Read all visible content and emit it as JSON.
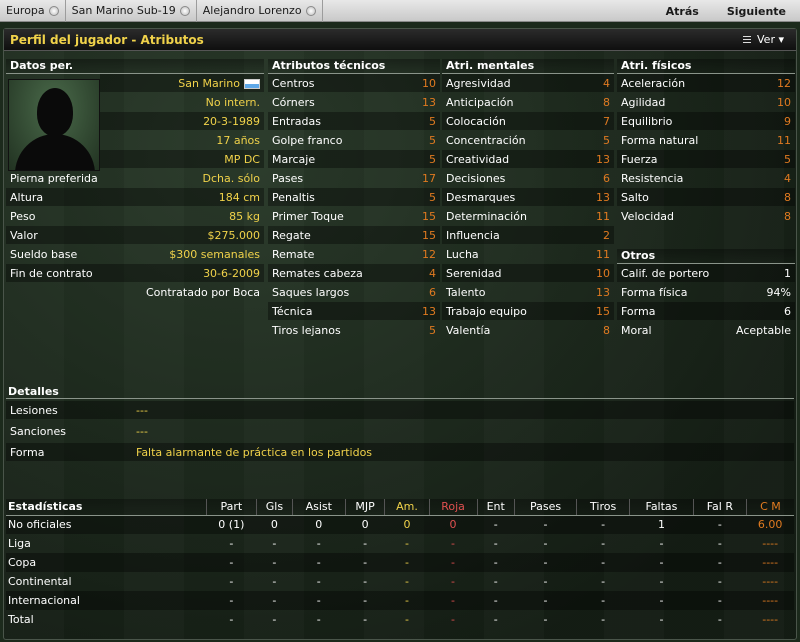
{
  "nav": {
    "crumbs": [
      "Europa",
      "San Marino Sub-19",
      "Alejandro Lorenzo"
    ],
    "back": "Atrás",
    "next": "Siguiente"
  },
  "panel": {
    "title": "Perfil del jugador - Atributos",
    "view_button": "Ver"
  },
  "personal": {
    "header": "Datos per.",
    "nationality": "San Marino",
    "intl_status": "No intern.",
    "dob": "20-3-1989",
    "age": "17 años",
    "positions": "MP DC",
    "rows": [
      {
        "label": "Pierna preferida",
        "value": "Dcha. sólo"
      },
      {
        "label": "Altura",
        "value": "184 cm"
      },
      {
        "label": "Peso",
        "value": "85 kg"
      },
      {
        "label": "Valor",
        "value": "$275.000"
      },
      {
        "label": "Sueldo base",
        "value": "$300 semanales"
      },
      {
        "label": "Fin de contrato",
        "value": "30-6-2009"
      }
    ],
    "contract_note": "Contratado por Boca"
  },
  "technical": {
    "header": "Atributos técnicos",
    "items": [
      {
        "label": "Centros",
        "value": "10"
      },
      {
        "label": "Córners",
        "value": "13"
      },
      {
        "label": "Entradas",
        "value": "5"
      },
      {
        "label": "Golpe franco",
        "value": "5"
      },
      {
        "label": "Marcaje",
        "value": "5"
      },
      {
        "label": "Pases",
        "value": "17"
      },
      {
        "label": "Penaltis",
        "value": "5"
      },
      {
        "label": "Primer Toque",
        "value": "15"
      },
      {
        "label": "Regate",
        "value": "15"
      },
      {
        "label": "Remate",
        "value": "12"
      },
      {
        "label": "Remates cabeza",
        "value": "4"
      },
      {
        "label": "Saques largos",
        "value": "6"
      },
      {
        "label": "Técnica",
        "value": "13"
      },
      {
        "label": "Tiros lejanos",
        "value": "5"
      }
    ]
  },
  "mental": {
    "header": "Atri. mentales",
    "items": [
      {
        "label": "Agresividad",
        "value": "4"
      },
      {
        "label": "Anticipación",
        "value": "8"
      },
      {
        "label": "Colocación",
        "value": "7"
      },
      {
        "label": "Concentración",
        "value": "5"
      },
      {
        "label": "Creatividad",
        "value": "13"
      },
      {
        "label": "Decisiones",
        "value": "6"
      },
      {
        "label": "Desmarques",
        "value": "13"
      },
      {
        "label": "Determinación",
        "value": "11"
      },
      {
        "label": "Influencia",
        "value": "2"
      },
      {
        "label": "Lucha",
        "value": "11"
      },
      {
        "label": "Serenidad",
        "value": "10"
      },
      {
        "label": "Talento",
        "value": "13"
      },
      {
        "label": "Trabajo equipo",
        "value": "15"
      },
      {
        "label": "Valentía",
        "value": "8"
      }
    ]
  },
  "physical": {
    "header": "Atri. físicos",
    "items": [
      {
        "label": "Aceleración",
        "value": "12"
      },
      {
        "label": "Agilidad",
        "value": "10"
      },
      {
        "label": "Equilibrio",
        "value": "9"
      },
      {
        "label": "Forma natural",
        "value": "11"
      },
      {
        "label": "Fuerza",
        "value": "5"
      },
      {
        "label": "Resistencia",
        "value": "4"
      },
      {
        "label": "Salto",
        "value": "8"
      },
      {
        "label": "Velocidad",
        "value": "8"
      }
    ]
  },
  "others": {
    "header": "Otros",
    "items": [
      {
        "label": "Calif. de portero",
        "value": "1"
      },
      {
        "label": "Forma física",
        "value": "94%"
      },
      {
        "label": "Forma",
        "value": "6"
      },
      {
        "label": "Moral",
        "value": "Aceptable"
      }
    ]
  },
  "details": {
    "header": "Detalles",
    "items": [
      {
        "label": "Lesiones",
        "value": "---"
      },
      {
        "label": "Sanciones",
        "value": "---"
      },
      {
        "label": "Forma",
        "value": "Falta alarmante de práctica en los partidos"
      }
    ]
  },
  "stats": {
    "columns": [
      "Estadísticas",
      "Part",
      "Gls",
      "Asist",
      "MJP",
      "Am.",
      "Roja",
      "Ent",
      "Pases",
      "Tiros",
      "Faltas",
      "Fal R",
      "C M"
    ],
    "rows": [
      [
        "No oficiales",
        "0 (1)",
        "0",
        "0",
        "0",
        "0",
        "0",
        "-",
        "-",
        "-",
        "1",
        "-",
        "6.00"
      ],
      [
        "Liga",
        "-",
        "-",
        "-",
        "-",
        "-",
        "-",
        "-",
        "-",
        "-",
        "-",
        "-",
        "----"
      ],
      [
        "Copa",
        "-",
        "-",
        "-",
        "-",
        "-",
        "-",
        "-",
        "-",
        "-",
        "-",
        "-",
        "----"
      ],
      [
        "Continental",
        "-",
        "-",
        "-",
        "-",
        "-",
        "-",
        "-",
        "-",
        "-",
        "-",
        "-",
        "----"
      ],
      [
        "Internacional",
        "-",
        "-",
        "-",
        "-",
        "-",
        "-",
        "-",
        "-",
        "-",
        "-",
        "-",
        "----"
      ],
      [
        "Total",
        "-",
        "-",
        "-",
        "-",
        "-",
        "-",
        "-",
        "-",
        "-",
        "-",
        "-",
        "----"
      ]
    ]
  }
}
